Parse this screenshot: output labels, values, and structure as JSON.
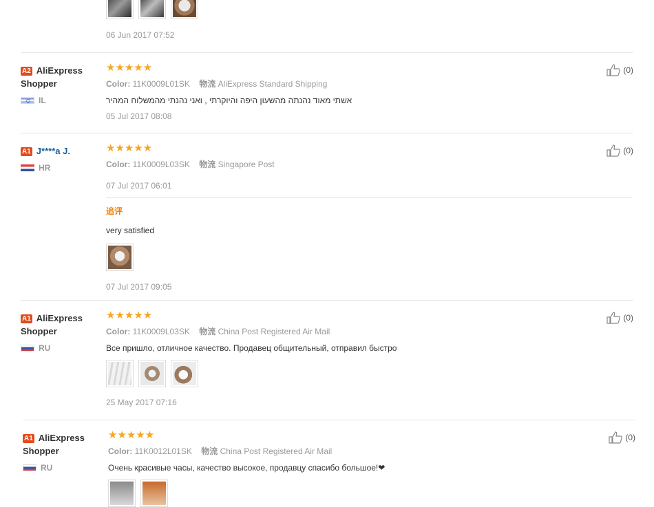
{
  "top": {
    "photos": [
      "photo-1",
      "photo-2",
      "photo-3"
    ],
    "date": "06 Jun 2017 07:52"
  },
  "reviews": [
    {
      "level": "A2",
      "name": "AliExpress Shopper",
      "country": "IL",
      "stars": "★★★★★",
      "color_label": "Color:",
      "color_value": "11K0009L01SK",
      "ship_label": "物流",
      "ship_value": "AliExpress Standard Shipping",
      "text": "אשתי מאוד נהנתה מהשעון היפה והיוקרתי , ואני נהנתי מהמשלוח המהיר",
      "date": "05 Jul 2017 08:08",
      "likes": "(0)"
    },
    {
      "level": "A1",
      "name": "J****a J.",
      "country": "HR",
      "stars": "★★★★★",
      "color_label": "Color:",
      "color_value": "11K0009L03SK",
      "ship_label": "物流",
      "ship_value": "Singapore Post",
      "date": "07 Jul 2017 06:01",
      "followup_label": "追评",
      "followup_text": "very satisfied",
      "followup_date": "07 Jul 2017 09:05",
      "likes": "(0)"
    },
    {
      "level": "A1",
      "name": "AliExpress Shopper",
      "country": "RU",
      "stars": "★★★★★",
      "color_label": "Color:",
      "color_value": "11K0009L03SK",
      "ship_label": "物流",
      "ship_value": "China Post Registered Air Mail",
      "text": "Все пришло, отличное качество. Продавец общительный, отправил быстро",
      "date": "25 May 2017 07:16",
      "likes": "(0)"
    },
    {
      "level": "A1",
      "name": "AliExpress Shopper",
      "country": "RU",
      "stars": "★★★★★",
      "color_label": "Color:",
      "color_value": "11K0012L01SK",
      "ship_label": "物流",
      "ship_value": "China Post Registered Air Mail",
      "text": "Очень красивые часы, качество высокое, продавцу спасибо большое!❤",
      "likes": "(0)"
    }
  ],
  "colors": {
    "star": "#f5a623",
    "level_badge": "#e44a1b",
    "followup": "#f08200"
  }
}
